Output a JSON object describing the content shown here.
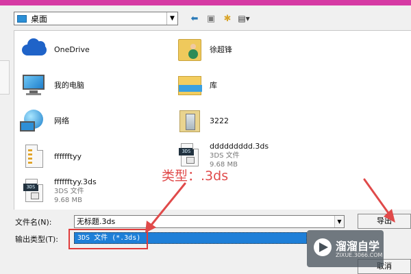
{
  "lookin": {
    "location": "桌面"
  },
  "toolbar": {
    "back_icon": "back-arrow-icon",
    "up_icon": "up-folder-icon",
    "new_icon": "new-folder-icon",
    "view_icon": "view-menu-icon"
  },
  "items": [
    {
      "name": "OneDrive",
      "icon": "onedrive-icon"
    },
    {
      "name": "我的电脑",
      "icon": "computer-icon"
    },
    {
      "name": "网络",
      "icon": "network-icon"
    },
    {
      "name": "fffffftyy",
      "icon": "zip-file-icon"
    },
    {
      "name": "fffffftyy.3ds",
      "type": "3DS 文件",
      "size": "9.68 MB",
      "icon": "3ds-file-icon"
    },
    {
      "name": "徐超锋",
      "icon": "user-folder-icon"
    },
    {
      "name": "库",
      "icon": "library-icon"
    },
    {
      "name": "3222",
      "icon": "image-folder-icon"
    },
    {
      "name": "ddddddddd.3ds",
      "type": "3DS 文件",
      "size": "9.68 MB",
      "icon": "3ds-file-icon"
    }
  ],
  "form": {
    "filename_label": "文件名(N):",
    "filename_value": "无标题.3ds",
    "savetype_label": "输出类型(T):",
    "savetype_value": "3DS 文件 (*.3ds)"
  },
  "buttons": {
    "export_label": "导出",
    "cancel_label": "取消"
  },
  "annotation": {
    "text": "类型：.3ds"
  },
  "watermark": {
    "title": "溜溜自学",
    "url": "ZIXUE.3066.COM"
  },
  "colors": {
    "accent": "#1e7fd8",
    "annotation": "#e04a4a",
    "titlebar": "#d63aa4"
  }
}
